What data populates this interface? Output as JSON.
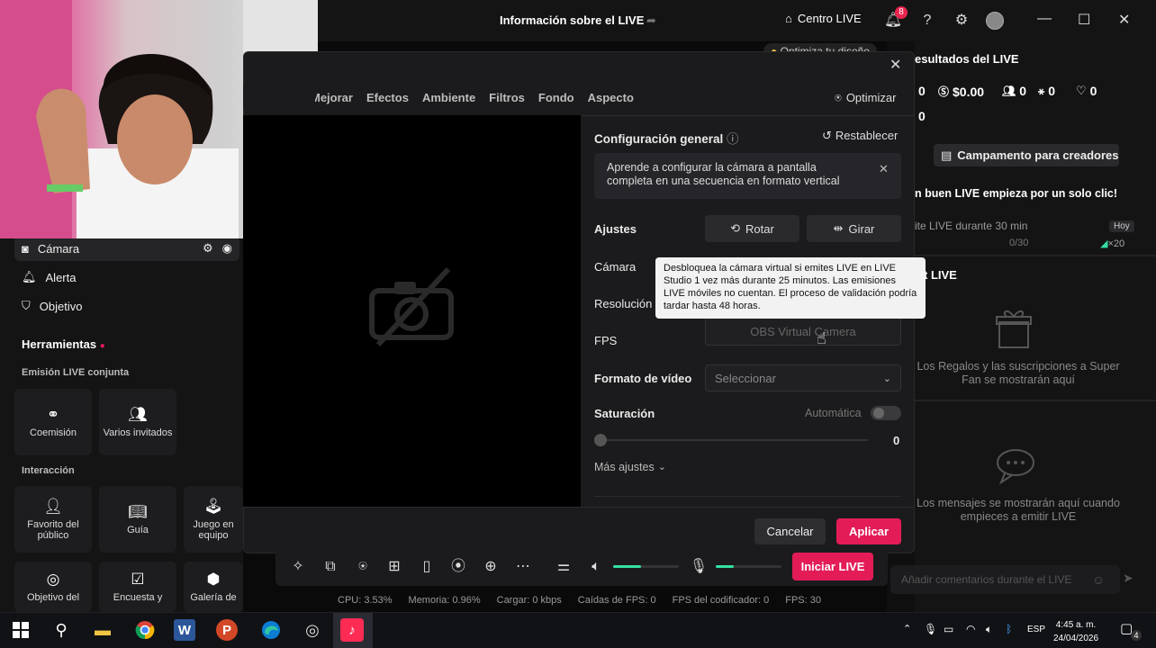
{
  "window": {
    "title": "Información sobre el LIVE",
    "centro_label": "Centro LIVE",
    "notif_count": "8"
  },
  "optimize_hint": "Optimiza tu diseño",
  "sidebar": {
    "items": [
      {
        "label": "Cámara"
      },
      {
        "label": "Alerta"
      },
      {
        "label": "Objetivo"
      }
    ],
    "tools_title": "Herramientas",
    "cohost_title": "Emisión LIVE conjunta",
    "cohost_tiles": [
      "Coemisión",
      "Varios invitados"
    ],
    "interaction_title": "Interacción",
    "interaction_tiles": [
      "Favorito del público",
      "Guía",
      "Juego en equipo"
    ],
    "extra_tiles": [
      "Objetivo del",
      "Encuesta y",
      "Galería de"
    ]
  },
  "modal": {
    "tabs": [
      "Mejorar",
      "Efectos",
      "Ambiente",
      "Filtros",
      "Fondo",
      "Aspecto"
    ],
    "optimize_label": "Optimizar",
    "general_title": "Configuración general",
    "reset_label": "Restablecer",
    "info_text": "Aprende a configurar la cámara a pantalla completa en una secuencia en formato vertical",
    "ajustes_label": "Ajustes",
    "rotate_label": "Rotar",
    "flip_label": "Girar",
    "camera_label": "Cámara",
    "resolution_label": "Resolución",
    "fps_label": "FPS",
    "camera_value": "OBS Virtual Camera",
    "tooltip_text": "Desbloquea la cámara virtual si emites LIVE en LIVE Studio 1 vez más durante 25 minutos. Las emisiones LIVE móviles no cuentan. El proceso de validación podría tardar hasta 48 horas.",
    "video_format_label": "Formato de vídeo",
    "video_format_placeholder": "Seleccionar",
    "saturation_label": "Saturación",
    "auto_label": "Automática",
    "saturation_value": "0",
    "more_label": "Más ajustes",
    "cancel_label": "Cancelar",
    "apply_label": "Aplicar"
  },
  "right": {
    "results_title": "esultados del LIVE",
    "stats": [
      "0",
      "$0.00",
      "0",
      "0",
      "0"
    ],
    "stats_row2": "0",
    "camp_label": "Campamento para creadores",
    "promo_text": "n buen LIVE empieza por un solo clic!",
    "task_text": "ite LIVE durante 30 min",
    "task_badge": "Hoy",
    "task_progress": "0/30",
    "task_reward": "×20",
    "gifts_title": "t LIVE",
    "gifts_text": "Los Regalos y las suscripciones a Super Fan se mostrarán aquí",
    "messages_text": "Los mensajes se mostrarán aquí cuando empieces a emitir LIVE",
    "comment_placeholder": "Añadir comentarios durante el LIVE"
  },
  "controls": {
    "start_live": "Iniciar LIVE",
    "speaker_level": 0.42,
    "mic_level": 0.28,
    "stats": [
      "CPU:  3.53%",
      "Memoria:  0.96%",
      "Cargar:  0 kbps",
      "Caídas de FPS:  0",
      "FPS del codificador:  0",
      "FPS:  30"
    ]
  },
  "taskbar": {
    "lang": "ESP",
    "time": "4:45 a. m.",
    "date": "24/04/2026",
    "notif": "4"
  },
  "colors": {
    "accent": "#e31c58",
    "meter": "#33e0a4"
  }
}
